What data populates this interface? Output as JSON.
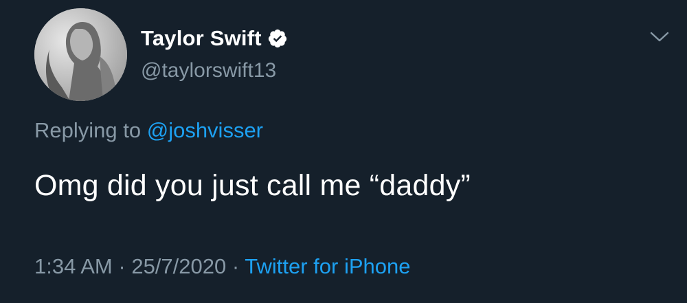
{
  "user": {
    "display_name": "Taylor Swift",
    "handle": "@taylorswift13",
    "verified": true
  },
  "reply": {
    "prefix": "Replying to",
    "mention": "@joshvisser"
  },
  "tweet": {
    "text": "Omg did you just call me “daddy”"
  },
  "meta": {
    "time": "1:34 AM",
    "separator": "·",
    "date": "25/7/2020",
    "source": "Twitter for iPhone"
  },
  "icons": {
    "verified": "verified-badge-icon",
    "menu": "chevron-down-icon"
  },
  "colors": {
    "background": "#15202b",
    "primary_text": "#ffffff",
    "secondary_text": "#8899a6",
    "link": "#1da1f2"
  }
}
